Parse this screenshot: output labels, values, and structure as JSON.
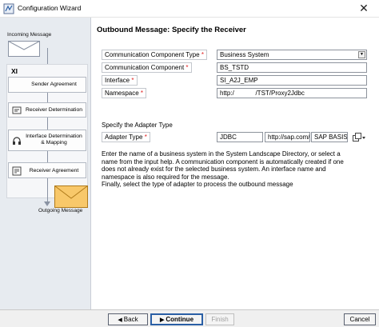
{
  "window": {
    "title": "Configuration Wizard",
    "close_symbol": "✕"
  },
  "sidebar": {
    "incoming_label": "Incoming Message",
    "xi_label": "XI",
    "steps": [
      {
        "label": "Sender Agreement"
      },
      {
        "label": "Receiver Determination"
      },
      {
        "label": "Interface Determination & Mapping"
      },
      {
        "label": "Receiver Agreement"
      }
    ],
    "outgoing_label": "Outgoing Message"
  },
  "main": {
    "heading": "Outbound Message: Specify the Receiver",
    "fields": [
      {
        "label": "Communication Component Type",
        "value": "Business System"
      },
      {
        "label": "Communication Component",
        "value": "BS_TSTD"
      },
      {
        "label": "Interface",
        "value": "SI_A2J_EMP"
      },
      {
        "label": "Namespace",
        "value": "http:/            /TST/Proxy2Jdbc"
      }
    ],
    "required_marker": "*",
    "adapter_section_label": "Specify the Adapter Type",
    "adapter": {
      "label": "Adapter Type",
      "type_value": "JDBC",
      "namespace_value": "http://sap.com/",
      "swc_value": "SAP BASIS"
    },
    "info_lines": [
      "Enter the name of a business system in the System Landscape Directory, or select a",
      "name from the input help. A communication component is automatically created if one",
      "does not already exist for the selected business system. An interface name and",
      "namespace is also required for the message.",
      "Finally, select the type of adapter to process the outbound message"
    ]
  },
  "footer": {
    "back_label": "Back",
    "continue_label": "Continue",
    "finish_label": "Finish",
    "cancel_label": "Cancel"
  }
}
